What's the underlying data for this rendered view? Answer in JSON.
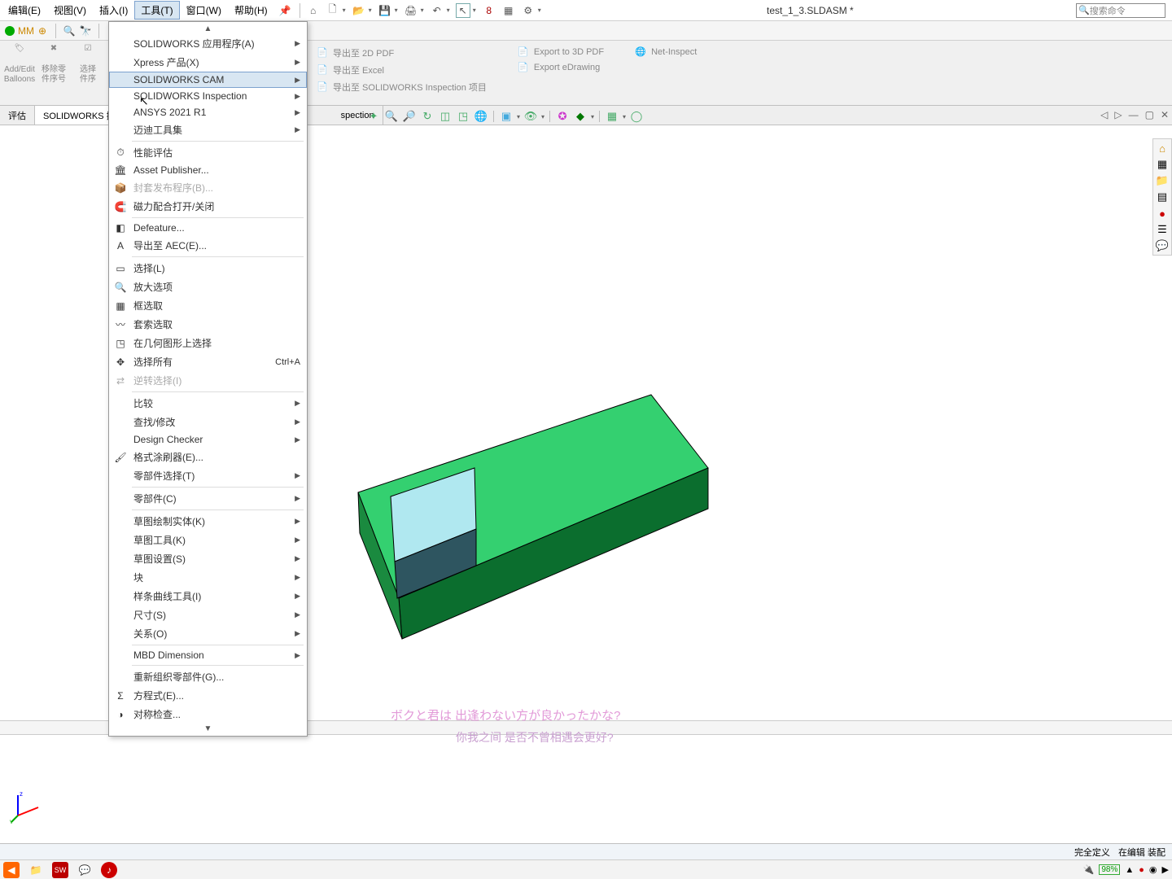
{
  "menubar": {
    "items": [
      "编辑(E)",
      "视图(V)",
      "插入(I)",
      "工具(T)",
      "窗口(W)",
      "帮助(H)"
    ],
    "active_index": 3,
    "doc_title": "test_1_3.SLDASM *",
    "search_placeholder": "搜索命令"
  },
  "ribbon_left": {
    "buttons": [
      {
        "line1": "Add/Edit",
        "line2": "Balloons"
      },
      {
        "line1": "移除零",
        "line2": "件序号"
      },
      {
        "line1": "选择",
        "line2": "件序"
      }
    ]
  },
  "export_panel": {
    "col1": [
      "导出至 2D PDF",
      "导出至 Excel",
      "导出至 SOLIDWORKS Inspection 项目"
    ],
    "col2": [
      "Export to 3D PDF",
      "Export eDrawing"
    ],
    "col3": [
      "Net-Inspect"
    ]
  },
  "tabs": {
    "items": [
      "评估",
      "SOLIDWORKS 插件",
      "spection"
    ],
    "active_index": 1
  },
  "tools_menu": {
    "groups": [
      [
        {
          "label": "SOLIDWORKS 应用程序(A)",
          "arrow": true
        },
        {
          "label": "Xpress 产品(X)",
          "arrow": true
        },
        {
          "label": "SOLIDWORKS CAM",
          "arrow": true,
          "highlighted": true
        },
        {
          "label": "SOLIDWORKS Inspection",
          "arrow": true
        },
        {
          "label": "ANSYS 2021 R1",
          "arrow": true
        },
        {
          "label": "迈迪工具集",
          "arrow": true
        }
      ],
      [
        {
          "label": "性能评估",
          "icon": "⏱"
        },
        {
          "label": "Asset Publisher...",
          "icon": "🏛"
        },
        {
          "label": "封套发布程序(B)...",
          "icon": "📦",
          "disabled": true
        },
        {
          "label": "磁力配合打开/关闭",
          "icon": "🧲"
        }
      ],
      [
        {
          "label": "Defeature...",
          "icon": "◧"
        },
        {
          "label": "导出至 AEC(E)...",
          "icon": "A"
        }
      ],
      [
        {
          "label": "选择(L)",
          "icon": "▭"
        },
        {
          "label": "放大选项",
          "icon": "🔍"
        },
        {
          "label": "框选取",
          "icon": "▦"
        },
        {
          "label": "套索选取",
          "icon": "〰"
        },
        {
          "label": "在几何图形上选择",
          "icon": "◳"
        },
        {
          "label": "选择所有",
          "icon": "✥",
          "shortcut": "Ctrl+A"
        },
        {
          "label": "逆转选择(I)",
          "icon": "⇄",
          "disabled": true
        }
      ],
      [
        {
          "label": "比较",
          "arrow": true
        },
        {
          "label": "查找/修改",
          "arrow": true
        },
        {
          "label": "Design Checker",
          "arrow": true
        },
        {
          "label": "格式涂刷器(E)...",
          "icon": "🖌"
        },
        {
          "label": "零部件选择(T)",
          "arrow": true
        }
      ],
      [
        {
          "label": "零部件(C)",
          "arrow": true
        }
      ],
      [
        {
          "label": "草图绘制实体(K)",
          "arrow": true
        },
        {
          "label": "草图工具(K)",
          "arrow": true
        },
        {
          "label": "草图设置(S)",
          "arrow": true
        },
        {
          "label": "块",
          "arrow": true
        },
        {
          "label": "样条曲线工具(I)",
          "arrow": true
        },
        {
          "label": "尺寸(S)",
          "arrow": true
        },
        {
          "label": "关系(O)",
          "arrow": true
        }
      ],
      [
        {
          "label": "MBD Dimension",
          "arrow": true
        }
      ],
      [
        {
          "label": "重新组织零部件(G)..."
        },
        {
          "label": "方程式(E)...",
          "icon": "Σ"
        },
        {
          "label": "对称检查...",
          "icon": "◑"
        }
      ]
    ]
  },
  "subtitles": {
    "line1": "ボクと君は 出逢わない方が良かったかな?",
    "line2": "你我之间 是否不曾相遇会更好?"
  },
  "statusbar": {
    "status1": "完全定义",
    "status2": "在编辑 装配"
  },
  "taskbar": {
    "battery": "98%"
  }
}
